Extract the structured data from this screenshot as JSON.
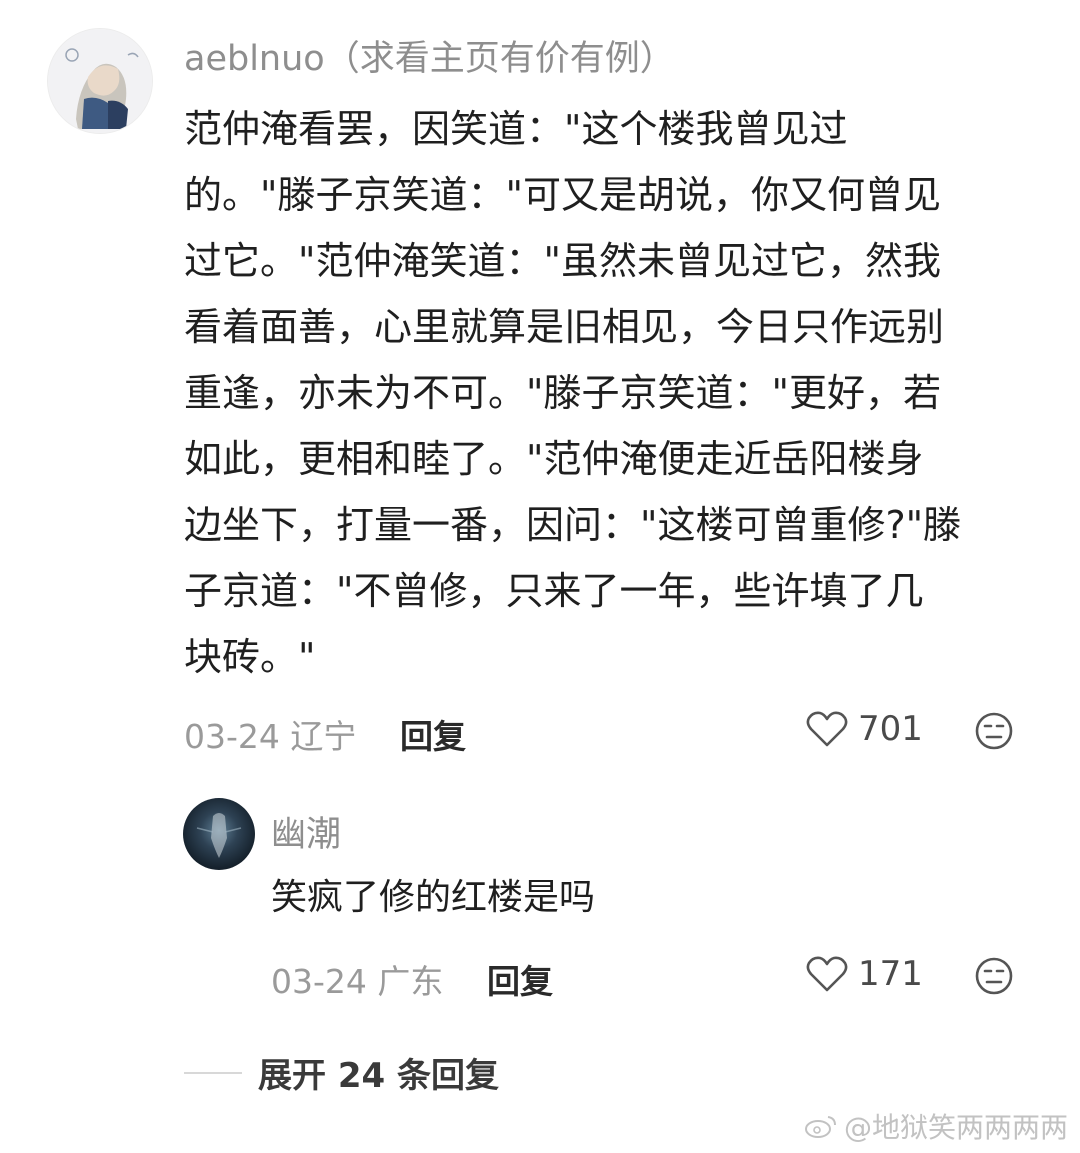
{
  "main_comment": {
    "username": "aeblnuo（求看主页有价有例）",
    "text_lines": [
      "范仲淹看罢，因笑道：\"这个楼我曾见过",
      "的。\"滕子京笑道：\"可又是胡说，你又何曾见",
      "过它。\"范仲淹笑道：\"虽然未曾见过它，然我",
      "看着面善，心里就算是旧相见，今日只作远别",
      "重逢，亦未为不可。\"滕子京笑道：\"更好，若",
      "如此，更相和睦了。\"范仲淹便走近岳阳楼身",
      "边坐下，打量一番，因问：\"这楼可曾重修?\"滕",
      "子京道：\"不曾修，只来了一年，些许填了几",
      "块砖。\""
    ],
    "date": "03-24",
    "location": "辽宁",
    "reply_label": "回复",
    "likes": "701"
  },
  "reply_comment": {
    "username": "幽潮",
    "text": "笑疯了修的红楼是吗",
    "date": "03-24",
    "location": "广东",
    "reply_label": "回复",
    "likes": "171"
  },
  "expand_replies": "展开 24 条回复",
  "watermark": "@地狱笑两两两两"
}
